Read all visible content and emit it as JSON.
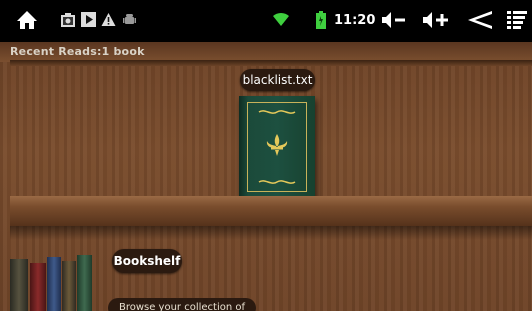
{
  "status_bar": {
    "icons": [
      "home-icon",
      "screenshot-icon",
      "play-icon",
      "warning-icon",
      "android-debug-icon",
      "wifi-icon",
      "battery-icon",
      "volume-down-icon",
      "volume-up-icon",
      "back-icon",
      "menu-icon"
    ],
    "clock": "11:20",
    "colors": {
      "background": "#000000",
      "wifi": "#3fcf3f",
      "battery": "#3fcf3f"
    }
  },
  "recent": {
    "label": "Recent Reads:1 book",
    "book_title": "blacklist.txt"
  },
  "bookshelf": {
    "title": "Bookshelf",
    "subtitle": "Browse your collection of books"
  }
}
